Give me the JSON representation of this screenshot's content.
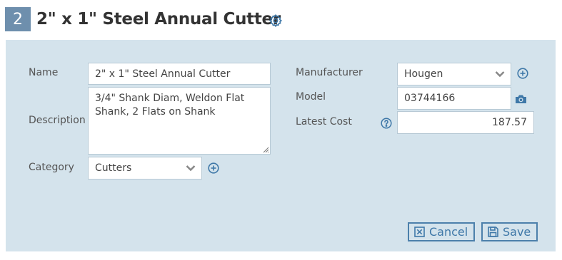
{
  "header": {
    "number": "2",
    "title": "2\" x 1\" Steel Annual Cutter",
    "settings_icon": "gear-icon"
  },
  "form": {
    "name": {
      "label": "Name",
      "value": "2\" x 1\" Steel Annual Cutter"
    },
    "description": {
      "label": "Description",
      "value": "3/4\" Shank Diam, Weldon Flat Shank, 2 Flats on Shank"
    },
    "category": {
      "label": "Category",
      "value": "Cutters",
      "add_icon": "plus-circle-icon"
    },
    "manufacturer": {
      "label": "Manufacturer",
      "value": "Hougen",
      "add_icon": "plus-circle-icon"
    },
    "model": {
      "label": "Model",
      "value": "03744166",
      "scan_icon": "camera-icon"
    },
    "latest_cost": {
      "label": "Latest Cost",
      "value": "187.57",
      "help_icon": "question-circle-icon"
    }
  },
  "actions": {
    "cancel_label": "Cancel",
    "save_label": "Save"
  },
  "colors": {
    "panel_bg": "#d4e3ec",
    "badge_bg": "#6e8fad",
    "accent": "#3f78a8"
  }
}
